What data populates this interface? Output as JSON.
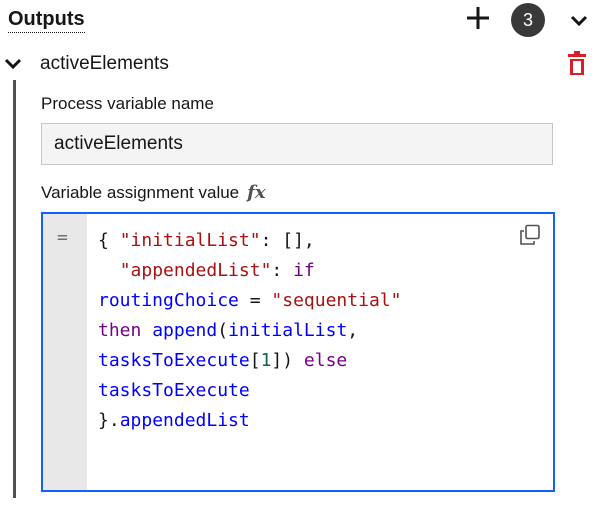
{
  "header": {
    "title": "Outputs",
    "count": "3"
  },
  "entry": {
    "name": "activeElements"
  },
  "fields": {
    "process_variable_label": "Process variable name",
    "process_variable_value": "activeElements",
    "assignment_label": "Variable assignment value",
    "fx_label": "fx"
  },
  "editor": {
    "gutter_symbol": "=",
    "lines": [
      [
        {
          "t": "{ ",
          "c": "p"
        },
        {
          "t": "\"initialList\"",
          "c": "s"
        },
        {
          "t": ": [],",
          "c": "p"
        }
      ],
      [
        {
          "t": "  ",
          "c": "p"
        },
        {
          "t": "\"appendedList\"",
          "c": "s"
        },
        {
          "t": ": ",
          "c": "p"
        },
        {
          "t": "if",
          "c": "k"
        }
      ],
      [
        {
          "t": "routingChoice",
          "c": "v"
        },
        {
          "t": " = ",
          "c": "p"
        },
        {
          "t": "\"sequential\"",
          "c": "s"
        }
      ],
      [
        {
          "t": "then",
          "c": "k"
        },
        {
          "t": " ",
          "c": "p"
        },
        {
          "t": "append",
          "c": "v"
        },
        {
          "t": "(",
          "c": "p"
        },
        {
          "t": "initialList",
          "c": "v"
        },
        {
          "t": ",",
          "c": "p"
        }
      ],
      [
        {
          "t": "tasksToExecute",
          "c": "v"
        },
        {
          "t": "[",
          "c": "p"
        },
        {
          "t": "1",
          "c": "n"
        },
        {
          "t": "]) ",
          "c": "p"
        },
        {
          "t": "else",
          "c": "k"
        }
      ],
      [
        {
          "t": "tasksToExecute",
          "c": "v"
        }
      ],
      [
        {
          "t": "}.",
          "c": "p"
        },
        {
          "t": "appendedList",
          "c": "v"
        }
      ]
    ]
  },
  "colors": {
    "accent": "#0f62fe",
    "delete": "#da1e28",
    "badge": "#393939",
    "keyword": "#770088",
    "string": "#aa1111",
    "variable": "#0000ff",
    "number": "#116644"
  },
  "icons": {
    "add": "plus-icon",
    "collapse": "chevron-down-icon",
    "entry_toggle": "chevron-down-icon",
    "delete": "trash-icon",
    "copy": "copy-icon",
    "fx": "fx-icon"
  }
}
